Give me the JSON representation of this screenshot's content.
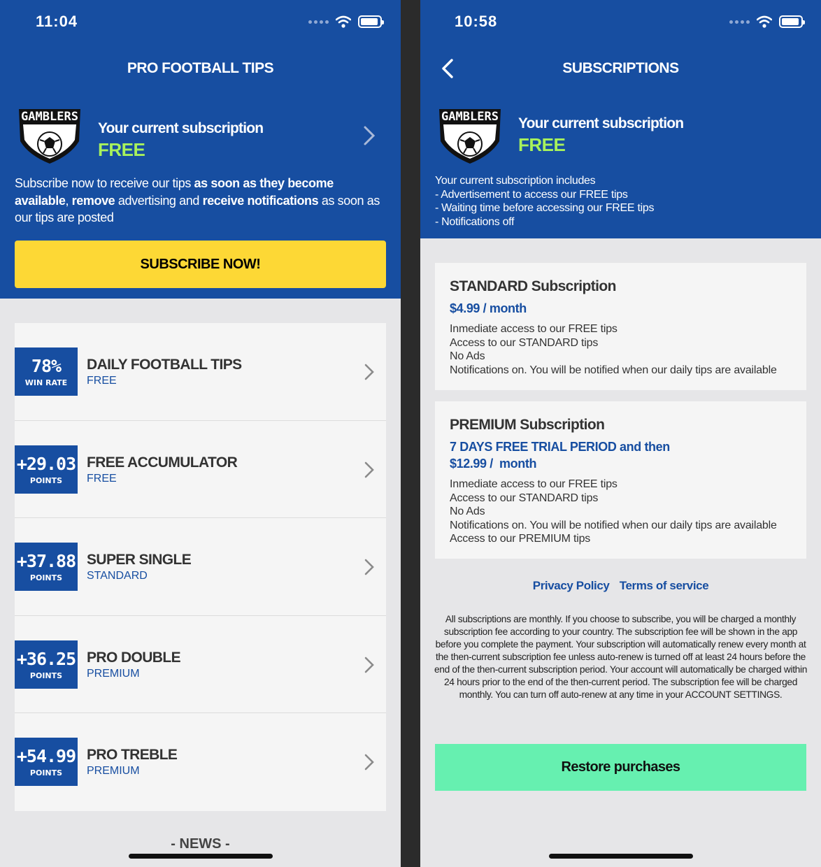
{
  "left": {
    "status_time": "11:04",
    "title": "PRO FOOTBALL TIPS",
    "logo_text": "GAMBLERS",
    "subscription_label": "Your current subscription",
    "subscription_value": "FREE",
    "promo": {
      "p1": "Subscribe now to receive our tips ",
      "b1": "as soon as they become available",
      "p2": ", ",
      "b2": "remove",
      "p3": " advertising and ",
      "b3": "receive notifications",
      "p4": " as soon as our tips are posted"
    },
    "subscribe_button": "SUBSCRIBE NOW!",
    "tips": [
      {
        "badge_value": "78%",
        "badge_unit": "WIN RATE",
        "title": "DAILY FOOTBALL TIPS",
        "level": "FREE"
      },
      {
        "badge_value": "+29.03",
        "badge_unit": "POINTS",
        "title": "FREE ACCUMULATOR",
        "level": "FREE"
      },
      {
        "badge_value": "+37.88",
        "badge_unit": "POINTS",
        "title": "SUPER SINGLE",
        "level": "STANDARD"
      },
      {
        "badge_value": "+36.25",
        "badge_unit": "POINTS",
        "title": "PRO DOUBLE",
        "level": "PREMIUM"
      },
      {
        "badge_value": "+54.99",
        "badge_unit": "POINTS",
        "title": "PRO TREBLE",
        "level": "PREMIUM"
      }
    ],
    "news_label": "- NEWS -"
  },
  "right": {
    "status_time": "10:58",
    "title": "SUBSCRIPTIONS",
    "logo_text": "GAMBLERS",
    "subscription_label": "Your current subscription",
    "subscription_value": "FREE",
    "includes": [
      "Your current subscription includes",
      "- Advertisement to access our FREE tips",
      "- Waiting time before accessing our FREE tips",
      "- Notifications off"
    ],
    "standard": {
      "title": "STANDARD Subscription",
      "price": "$4.99 / month",
      "features": [
        "Inmediate access to our FREE tips",
        "Access to our STANDARD tips",
        "No Ads",
        "Notifications on. You will be notified when our daily tips are available"
      ]
    },
    "premium": {
      "title": "PREMIUM Subscription",
      "trial": "7 DAYS FREE TRIAL PERIOD and then",
      "price": "$12.99 /  month",
      "features": [
        "Inmediate access to our FREE tips",
        "Access to our STANDARD tips",
        "No Ads",
        "Notifications on. You will be notified when our daily tips are available",
        "Access to our PREMIUM tips"
      ]
    },
    "privacy_link": "Privacy Policy",
    "terms_link": "Terms of service",
    "legal": "All subscriptions are monthly. If you choose to subscribe, you will be charged a monthly subscription fee according to your country. The subscription fee will be shown in the app before you complete the payment. Your subscription will automatically renew every month at the then-current subscription fee unless auto-renew is turned off at least 24 hours before the end of the then-current subscription period. Your account will automatically be charged within 24 hours prior to the end of the then-current period. The subscription fee will be charged monthly. You can turn off auto-renew at any time in your ACCOUNT SETTINGS.",
    "restore_button": "Restore purchases"
  },
  "colors": {
    "brand_blue": "#174ea1",
    "free_green": "#a8f25c",
    "subscribe_yellow": "#fdd835",
    "restore_green": "#66f0b0"
  },
  "icons": [
    "signal-dots-icon",
    "wifi-icon",
    "battery-icon",
    "chevron-right-icon",
    "back-chevron-icon",
    "gamblers-logo"
  ]
}
